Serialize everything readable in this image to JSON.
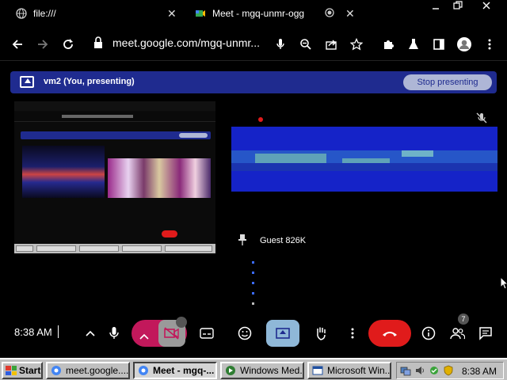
{
  "browser": {
    "tabs": [
      {
        "title": "file:///",
        "close": "✕"
      },
      {
        "title": "Meet - mgq-unmr-ogg",
        "close": "✕"
      }
    ],
    "new_tab": "✕",
    "url": "meet.google.com/mgq-unmr..."
  },
  "meet": {
    "banner_label": "vm2 (You, presenting)",
    "stop_presenting": "Stop presenting",
    "guest_name": "Guest 826K",
    "clock": "8:38 AM",
    "people_count": "7"
  },
  "taskbar": {
    "start": "Start",
    "tasks": [
      {
        "label": "meet.google...."
      },
      {
        "label": "Meet - mgq-..."
      },
      {
        "label": "Windows Med..."
      },
      {
        "label": "Microsoft Win..."
      }
    ],
    "time": "8:38 AM"
  },
  "colors": {
    "banner": "#1f2b8f",
    "end_call": "#e01b1b",
    "camera_off": "#c2185b",
    "present_active": "#8fb8d8"
  }
}
